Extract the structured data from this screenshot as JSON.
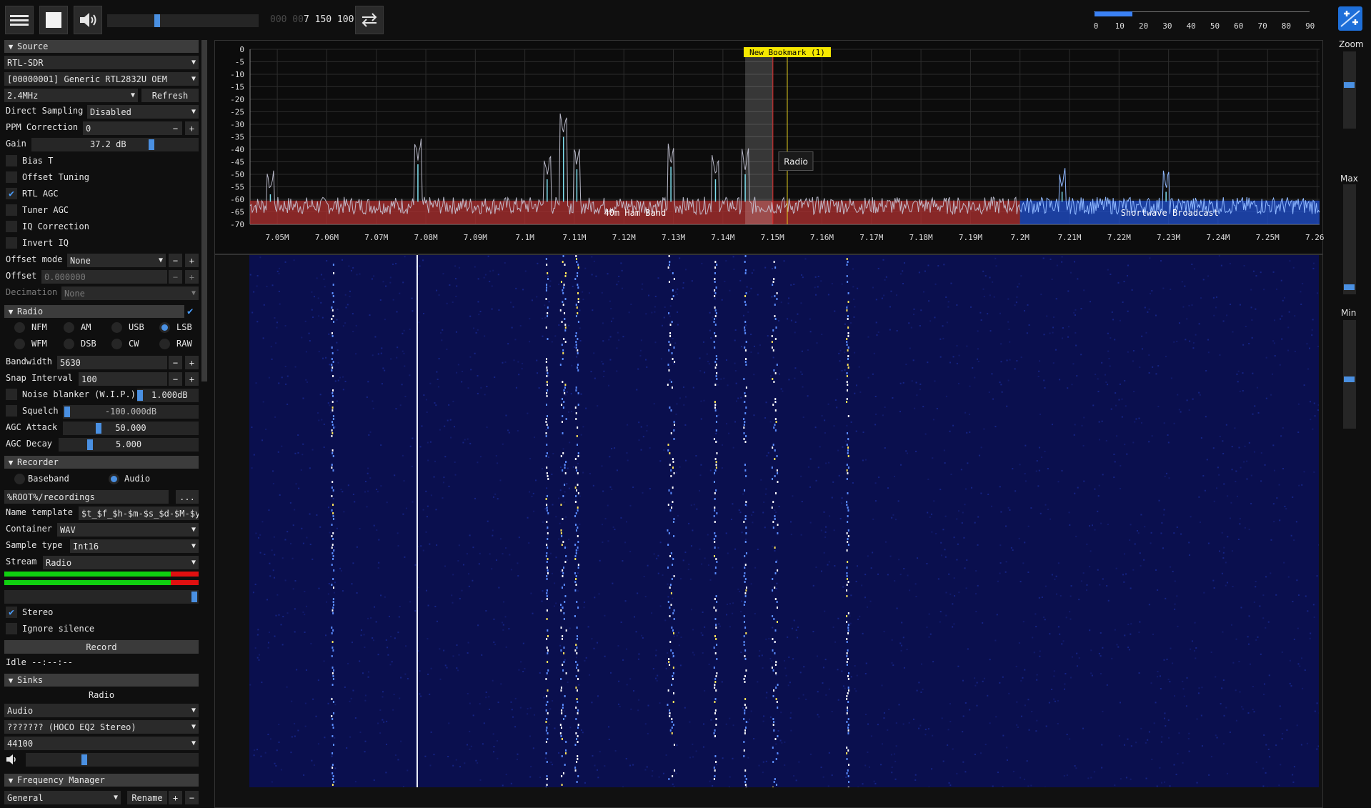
{
  "topbar": {
    "menu_icon": "hamburger-menu-icon",
    "play_icon": "stop-square-icon",
    "volume_icon": "speaker-icon",
    "volume_level": 0.36,
    "frequency_dim": "000 00",
    "frequency_bright": "7 150 100",
    "swap_icon": "swap-arrows-icon",
    "snr_ticks": [
      "0",
      "10",
      "20",
      "30",
      "40",
      "50",
      "60",
      "70",
      "80",
      "90"
    ],
    "snr_level": 16,
    "logo_icon": "sdrpp-logo-icon"
  },
  "source": {
    "header": "Source",
    "device_type": "RTL-SDR",
    "device": "[00000001] Generic RTL2832U OEM",
    "sample_rate": "2.4MHz",
    "refresh": "Refresh",
    "direct_sampling_label": "Direct Sampling",
    "direct_sampling_value": "Disabled",
    "ppm_label": "PPM Correction",
    "ppm_value": "0",
    "gain_label": "Gain",
    "gain_value": "37.2 dB",
    "bias_t": "Bias T",
    "offset_tuning": "Offset Tuning",
    "rtl_agc": "RTL AGC",
    "tuner_agc": "Tuner AGC",
    "iq_correction": "IQ Correction",
    "invert_iq": "Invert IQ",
    "offset_mode_label": "Offset mode",
    "offset_mode_value": "None",
    "offset_label": "Offset",
    "offset_value": "0.000000",
    "decimation_label": "Decimation",
    "decimation_value": "None"
  },
  "radio": {
    "header": "Radio",
    "modes": [
      "NFM",
      "AM",
      "USB",
      "LSB",
      "WFM",
      "DSB",
      "CW",
      "RAW"
    ],
    "selected_mode": "LSB",
    "bandwidth_label": "Bandwidth",
    "bandwidth_value": "5630",
    "snap_label": "Snap Interval",
    "snap_value": "100",
    "noise_blanker_label": "Noise blanker (W.I.P.)",
    "noise_blanker_value": "1.000dB",
    "squelch_label": "Squelch",
    "squelch_value": "-100.000dB",
    "agc_attack_label": "AGC Attack",
    "agc_attack_value": "50.000",
    "agc_decay_label": "AGC Decay",
    "agc_decay_value": "5.000"
  },
  "recorder": {
    "header": "Recorder",
    "baseband": "Baseband",
    "audio": "Audio",
    "path": "%ROOT%/recordings",
    "browse": "...",
    "name_template_label": "Name template",
    "name_template_value": "$t_$f_$h-$m-$s_$d-$M-$y",
    "container_label": "Container",
    "container_value": "WAV",
    "sample_type_label": "Sample type",
    "sample_type_value": "Int16",
    "stream_label": "Stream",
    "stream_value": "Radio",
    "stereo": "Stereo",
    "ignore_silence": "Ignore silence",
    "record_button": "Record",
    "status": "Idle --:--:--"
  },
  "sinks": {
    "header": "Sinks",
    "title": "Radio",
    "type": "Audio",
    "device": "??????? (HOCO EQ2 Stereo)",
    "rate": "44100"
  },
  "frequency_manager": {
    "header": "Frequency Manager",
    "list": "General",
    "rename": "Rename",
    "add": "+",
    "remove": "−"
  },
  "right": {
    "zoom_label": "Zoom",
    "max_label": "Max",
    "min_label": "Min"
  },
  "chart_data": {
    "type": "line",
    "y_ticks": [
      "0",
      "-5",
      "-10",
      "-15",
      "-20",
      "-25",
      "-30",
      "-35",
      "-40",
      "-45",
      "-50",
      "-55",
      "-60",
      "-65",
      "-70"
    ],
    "x_ticks": [
      "7.05M",
      "7.06M",
      "7.07M",
      "7.08M",
      "7.09M",
      "7.1M",
      "7.11M",
      "7.12M",
      "7.13M",
      "7.14M",
      "7.15M",
      "7.16M",
      "7.17M",
      "7.18M",
      "7.19M",
      "7.2M",
      "7.21M",
      "7.22M",
      "7.23M",
      "7.24M",
      "7.25M",
      "7.26M"
    ],
    "xlim": [
      7.0445,
      7.2605
    ],
    "ylim": [
      -70,
      0
    ],
    "peaks": [
      {
        "f": 7.0486,
        "db": -58
      },
      {
        "f": 7.0784,
        "db": -46
      },
      {
        "f": 7.1045,
        "db": -52
      },
      {
        "f": 7.1078,
        "db": -35
      },
      {
        "f": 7.1105,
        "db": -48
      },
      {
        "f": 7.1295,
        "db": -47
      },
      {
        "f": 7.1385,
        "db": -52
      },
      {
        "f": 7.1445,
        "db": -50
      },
      {
        "f": 7.2085,
        "db": -57
      },
      {
        "f": 7.2295,
        "db": -57
      }
    ],
    "noise_floor_db": -62,
    "bands": [
      {
        "name": "40m Ham Band",
        "from": 7.0445,
        "to": 7.2,
        "color": "#b03030"
      },
      {
        "name": "Shortwave Broadcast",
        "from": 7.2,
        "to": 7.2605,
        "color": "#2050d0"
      }
    ],
    "bookmark": {
      "label": "New Bookmark (1)",
      "f": 7.153
    },
    "vfo": {
      "label": "Radio",
      "center": 7.1501,
      "lower": 7.1445,
      "upper": 7.1501
    }
  }
}
